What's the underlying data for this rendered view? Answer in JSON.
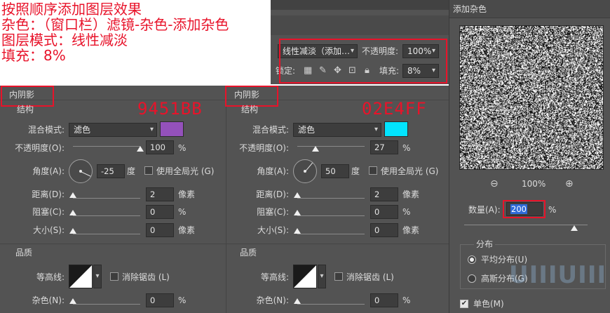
{
  "instructions": {
    "line1": "按照顺序添加图层效果",
    "line2": "杂色：（窗口栏）滤镜-杂色-添加杂色",
    "line3": "图层模式：线性减淡",
    "line4": "填充：8%"
  },
  "layers_bar": {
    "mode_value": "线性减淡（添加…",
    "opacity_label": "不透明度:",
    "opacity_value": "100%",
    "lock_label": "锁定:",
    "fill_label": "填充:",
    "fill_value": "8%"
  },
  "left_panel": {
    "title": "内阴影",
    "hex_color": "9451BB",
    "structure_heading": "结构",
    "blend_mode_label": "混合模式:",
    "blend_mode_value": "滤色",
    "swatch_color": "#9451bb",
    "opacity_label": "不透明度(O):",
    "opacity_value": "100",
    "opacity_unit": "%",
    "opacity_fraction": 1.0,
    "angle_label": "角度(A):",
    "angle_value": "-25",
    "angle_unit": "度",
    "global_light_label": "使用全局光 (G)",
    "distance_label": "距离(D):",
    "distance_value": "2",
    "distance_unit": "像素",
    "choke_label": "阻塞(C):",
    "choke_value": "0",
    "choke_unit": "%",
    "size_label": "大小(S):",
    "size_value": "0",
    "size_unit": "像素",
    "quality_heading": "品质",
    "contour_label": "等高线:",
    "antialias_label": "消除锯齿 (L)",
    "noise_label": "杂色(N):",
    "noise_value": "0",
    "noise_unit": "%"
  },
  "mid_panel": {
    "title": "内阴影",
    "hex_color": "02E4FF",
    "structure_heading": "结构",
    "blend_mode_label": "混合模式:",
    "blend_mode_value": "滤色",
    "swatch_color": "#02e4ff",
    "opacity_label": "不透明度(O):",
    "opacity_value": "27",
    "opacity_unit": "%",
    "opacity_fraction": 0.27,
    "angle_label": "角度(A):",
    "angle_value": "50",
    "angle_unit": "度",
    "global_light_label": "使用全局光 (G)",
    "distance_label": "距离(D):",
    "distance_value": "2",
    "distance_unit": "像素",
    "choke_label": "阻塞(C):",
    "choke_value": "0",
    "choke_unit": "%",
    "size_label": "大小(S):",
    "size_value": "0",
    "size_unit": "像素",
    "quality_heading": "品质",
    "contour_label": "等高线:",
    "antialias_label": "消除锯齿 (L)",
    "noise_label": "杂色(N):",
    "noise_value": "0",
    "noise_unit": "%"
  },
  "noise_dialog": {
    "title": "添加杂色",
    "zoom_value": "100%",
    "amount_label": "数量(A):",
    "amount_value": "200",
    "amount_unit": "%",
    "distribution_heading": "分布",
    "uniform_label": "平均分布(U)",
    "gaussian_label": "高斯分布(G)",
    "monochrome_label": "单色(M)",
    "watermark": "UIIIUIII"
  }
}
